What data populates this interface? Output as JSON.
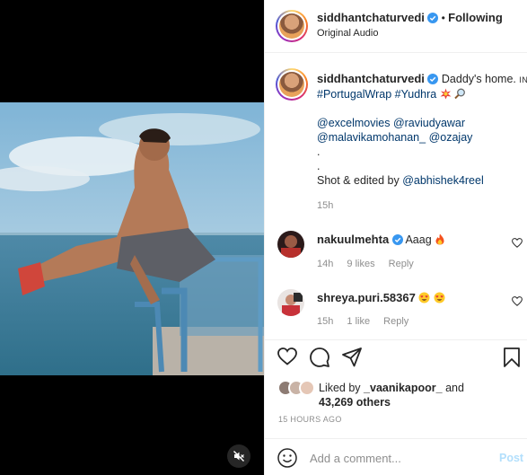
{
  "post": {
    "author": "siddhantchaturvedi",
    "follow_separator": "•",
    "follow_status": "Following",
    "audio": "Original Audio"
  },
  "caption": {
    "author": "siddhantchaturvedi",
    "text": "Daddy's home.",
    "in_label": "IN",
    "hashtag_1": "#PortugalWrap",
    "hashtag_2": "#Yudhra",
    "mention_1": "@excelmovies",
    "mention_2": "@raviudyawar",
    "mention_3": "@malavikamohanan_",
    "mention_4": "@ozajay",
    "dot_1": ".",
    "dot_2": ".",
    "shot_text": "Shot & edited by",
    "mention_5": "@abhishek4reel",
    "time": "15h"
  },
  "comments": [
    {
      "user": "nakuulmehta",
      "text": "Aaag",
      "time": "14h",
      "likes": "9 likes",
      "reply": "Reply"
    },
    {
      "user": "shreya.puri.58367",
      "text": "",
      "time": "15h",
      "likes": "1 like",
      "reply": "Reply"
    }
  ],
  "likes": {
    "prefix": "Liked by",
    "user": "_vaanikapoor_",
    "and": "and",
    "others": "43,269 others"
  },
  "time_ago": "15 HOURS AGO",
  "comment_box": {
    "placeholder": "Add a comment...",
    "post_label": "Post"
  },
  "colors": {
    "verified": "#3897f0",
    "link": "#00376b",
    "muted": "#8e8e8e",
    "post_button": "#b2dffc"
  }
}
